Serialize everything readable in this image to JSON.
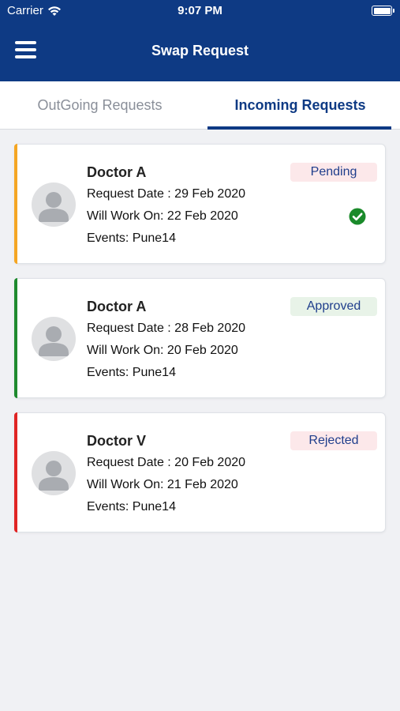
{
  "status_bar": {
    "carrier": "Carrier",
    "time": "9:07 PM"
  },
  "header": {
    "title": "Swap Request",
    "menu_icon": "hamburger-menu-icon"
  },
  "tabs": [
    {
      "label": "OutGoing Requests",
      "selected": false
    },
    {
      "label": "Incoming Requests",
      "selected": true
    }
  ],
  "requests": [
    {
      "name": "Doctor A",
      "request_date": "Request Date : 29 Feb 2020",
      "will_work_on": "Will Work On: 22 Feb 2020",
      "events": "Events: Pune14",
      "status": "Pending",
      "accent_color": "#f5a623",
      "badge_bg": "#fce8ea",
      "badge_text": "#1f3e8c",
      "show_check": true
    },
    {
      "name": "Doctor A",
      "request_date": "Request Date : 28 Feb 2020",
      "will_work_on": "Will Work On: 20 Feb 2020",
      "events": "Events: Pune14",
      "status": "Approved",
      "accent_color": "#1e8a2e",
      "badge_bg": "#e8f3e8",
      "badge_text": "#1f3e8c",
      "show_check": false
    },
    {
      "name": "Doctor V",
      "request_date": "Request Date : 20 Feb 2020",
      "will_work_on": "Will Work On: 21 Feb 2020",
      "events": "Events: Pune14",
      "status": "Rejected",
      "accent_color": "#e02424",
      "badge_bg": "#fce8ea",
      "badge_text": "#1f3e8c",
      "show_check": false
    }
  ],
  "colors": {
    "primary": "#0e3a84",
    "check": "#1a8a2a"
  }
}
